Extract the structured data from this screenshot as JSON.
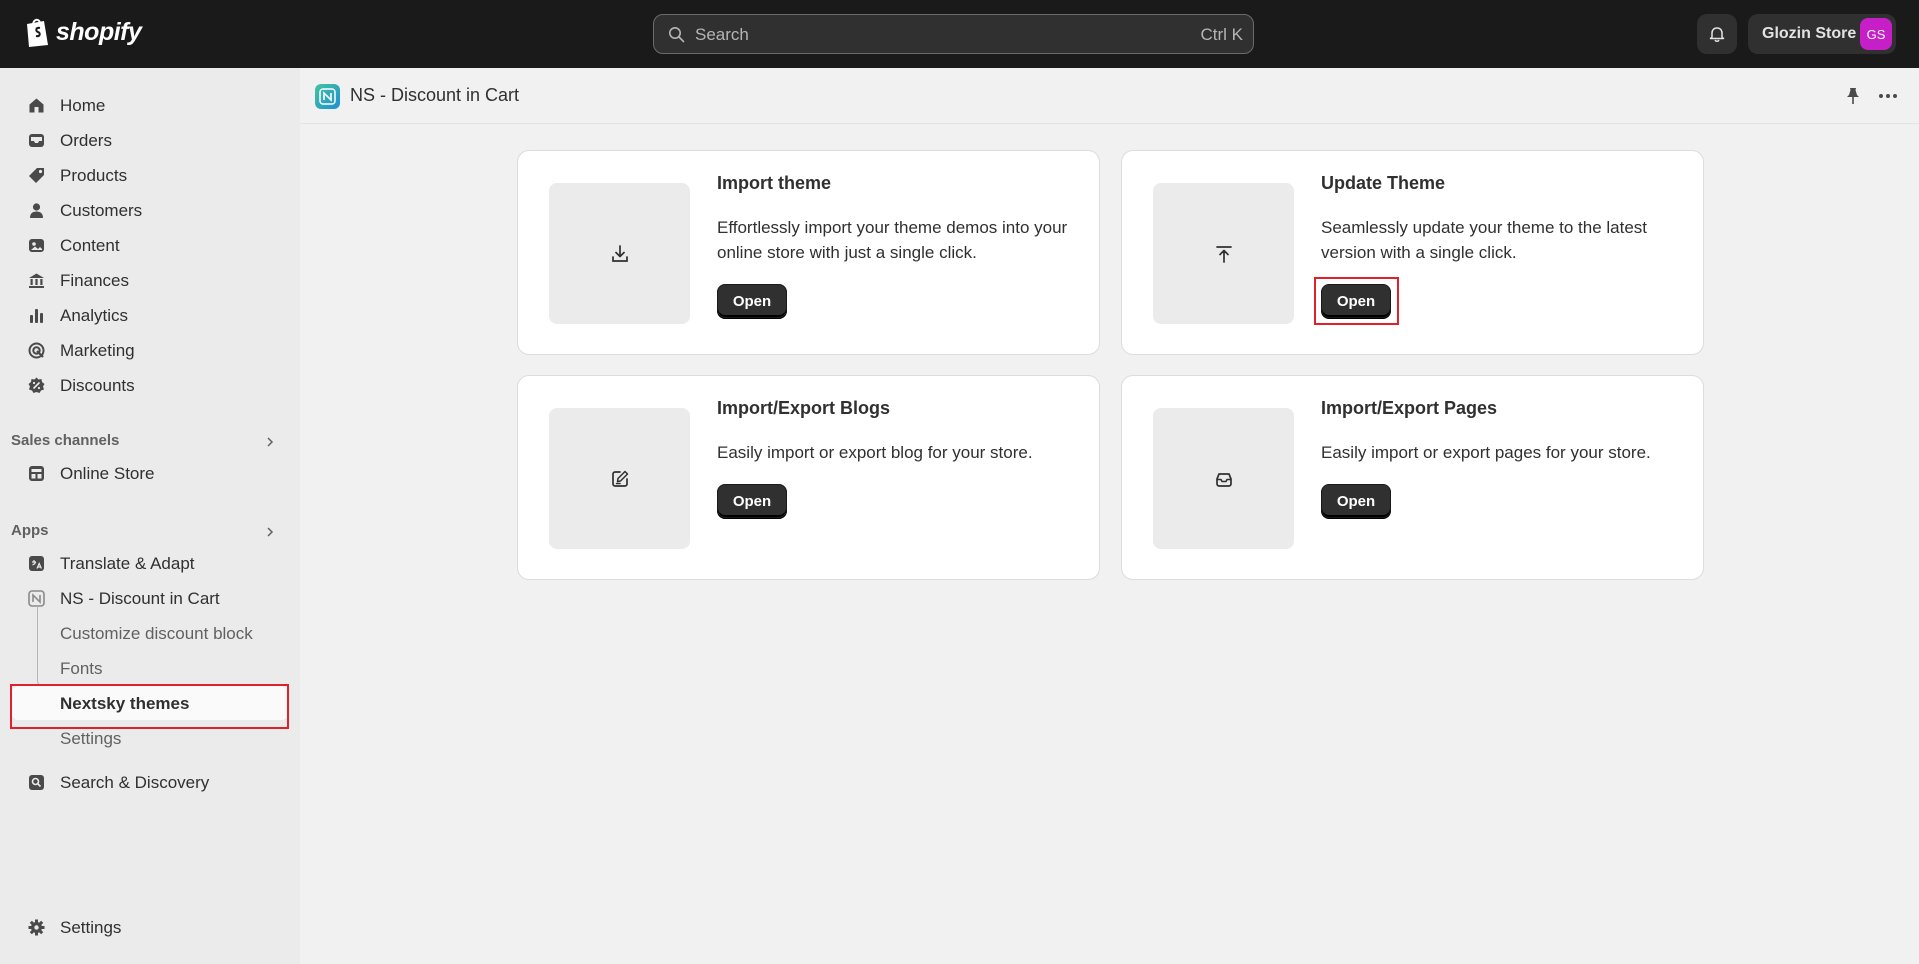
{
  "topbar": {
    "brand": "shopify",
    "search_placeholder": "Search",
    "search_shortcut": "Ctrl K",
    "store_name": "Glozin Store",
    "avatar_initials": "GS",
    "avatar_color": "#c71fc7"
  },
  "sidebar": {
    "main_items": [
      {
        "label": "Home",
        "icon": "home-icon"
      },
      {
        "label": "Orders",
        "icon": "inbox-icon"
      },
      {
        "label": "Products",
        "icon": "tag-icon"
      },
      {
        "label": "Customers",
        "icon": "person-icon"
      },
      {
        "label": "Content",
        "icon": "content-icon"
      },
      {
        "label": "Finances",
        "icon": "bank-icon"
      },
      {
        "label": "Analytics",
        "icon": "bar-chart-icon"
      },
      {
        "label": "Marketing",
        "icon": "target-icon"
      },
      {
        "label": "Discounts",
        "icon": "discount-icon"
      }
    ],
    "sales_channels_title": "Sales channels",
    "online_store": "Online Store",
    "apps_title": "Apps",
    "translate": "Translate & Adapt",
    "ns_app": "NS - Discount in Cart",
    "sub_items": [
      {
        "label": "Customize discount block"
      },
      {
        "label": "Fonts"
      },
      {
        "label": "Nextsky themes",
        "active": true
      },
      {
        "label": "Settings"
      }
    ],
    "search_discovery": "Search & Discovery",
    "settings": "Settings"
  },
  "page": {
    "title": "NS - Discount in Cart",
    "cards": [
      {
        "title": "Import theme",
        "description": "Effortlessly import your theme demos into your online store with just a single click.",
        "button": "Open",
        "icon": "download-icon"
      },
      {
        "title": "Update Theme",
        "description": "Seamlessly update your theme to the latest version with a single click.",
        "button": "Open",
        "icon": "upload-icon"
      },
      {
        "title": "Import/Export Blogs",
        "description": "Easily import or export blog for your store.",
        "button": "Open",
        "icon": "edit-icon"
      },
      {
        "title": "Import/Export Pages",
        "description": "Easily import or export pages for your store.",
        "button": "Open",
        "icon": "tray-icon"
      }
    ]
  },
  "colors": {
    "topbar": "#1a1a1a",
    "sidebar": "#ebebeb",
    "button": "#303030",
    "highlight": "#e0202b"
  }
}
